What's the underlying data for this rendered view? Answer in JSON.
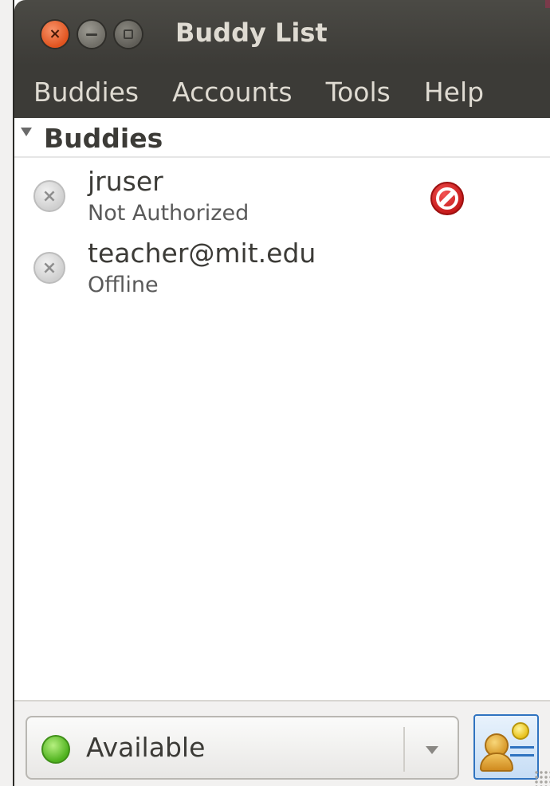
{
  "window": {
    "title": "Buddy List"
  },
  "menubar": {
    "items": [
      "Buddies",
      "Accounts",
      "Tools",
      "Help"
    ]
  },
  "buddy_list": {
    "group": {
      "label": "Buddies",
      "expanded": true
    },
    "buddies": [
      {
        "name": "jruser",
        "status": "Not Authorized",
        "status_icon": "offline-icon",
        "emblem": "blocked-icon"
      },
      {
        "name": "teacher@mit.edu",
        "status": "Offline",
        "status_icon": "offline-icon",
        "emblem": ""
      }
    ]
  },
  "status_bar": {
    "status_label": "Available",
    "status_icon": "available-icon",
    "status_color": "#4fb21e"
  },
  "colors": {
    "titlebar": "#3c3b37",
    "close_button": "#e0531e",
    "menu_text": "#dfdbd2"
  }
}
